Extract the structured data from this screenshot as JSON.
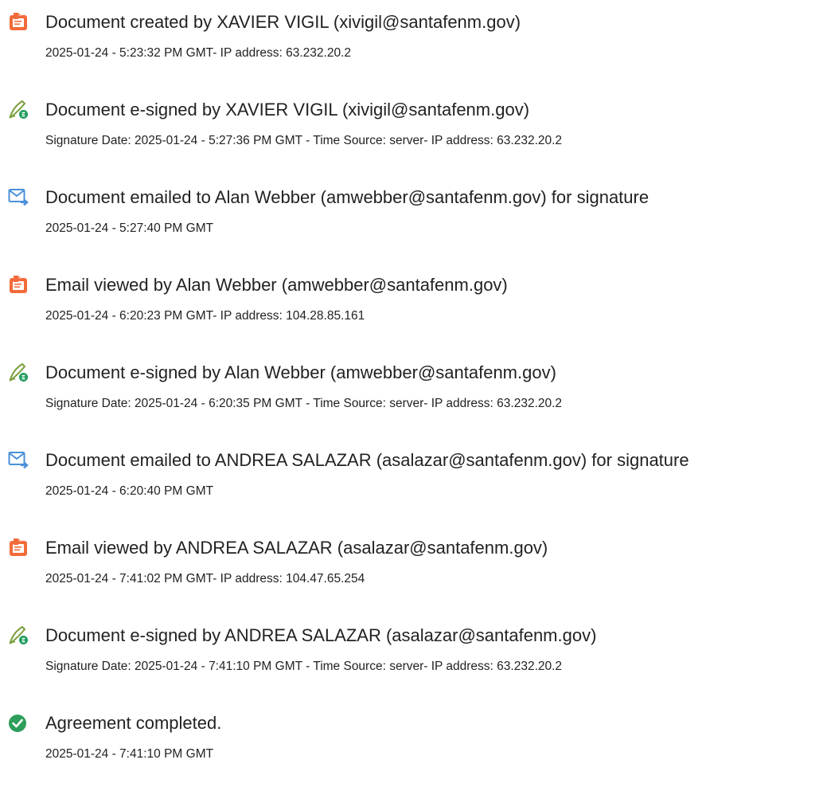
{
  "events": [
    {
      "icon": "document-created-icon",
      "title": "Document created by XAVIER VIGIL (xivigil@santafenm.gov)",
      "detail": "2025-01-24 - 5:23:32 PM GMT- IP address: 63.232.20.2"
    },
    {
      "icon": "e-signed-icon",
      "title": "Document e-signed by XAVIER VIGIL (xivigil@santafenm.gov)",
      "detail": "Signature Date: 2025-01-24 - 5:27:36 PM GMT - Time Source: server- IP address: 63.232.20.2"
    },
    {
      "icon": "email-sent-icon",
      "title": "Document emailed to Alan Webber (amwebber@santafenm.gov) for signature",
      "detail": "2025-01-24 - 5:27:40 PM GMT"
    },
    {
      "icon": "email-viewed-icon",
      "title": "Email viewed by Alan Webber (amwebber@santafenm.gov)",
      "detail": "2025-01-24 - 6:20:23 PM GMT- IP address: 104.28.85.161"
    },
    {
      "icon": "e-signed-icon",
      "title": "Document e-signed by Alan Webber (amwebber@santafenm.gov)",
      "detail": "Signature Date: 2025-01-24 - 6:20:35 PM GMT - Time Source: server- IP address: 63.232.20.2"
    },
    {
      "icon": "email-sent-icon",
      "title": "Document emailed to ANDREA SALAZAR (asalazar@santafenm.gov) for signature",
      "detail": "2025-01-24 - 6:20:40 PM GMT"
    },
    {
      "icon": "email-viewed-icon",
      "title": "Email viewed by ANDREA SALAZAR (asalazar@santafenm.gov)",
      "detail": "2025-01-24 - 7:41:02 PM GMT- IP address: 104.47.65.254"
    },
    {
      "icon": "e-signed-icon",
      "title": "Document e-signed by ANDREA SALAZAR (asalazar@santafenm.gov)",
      "detail": "Signature Date: 2025-01-24 - 7:41:10 PM GMT - Time Source: server- IP address: 63.232.20.2"
    },
    {
      "icon": "agreement-completed-icon",
      "title": "Agreement completed.",
      "detail": "2025-01-24 - 7:41:10 PM GMT"
    }
  ],
  "colors": {
    "document_icon": "#f26b3a",
    "sign_icon": "#7a9e3c",
    "sign_badge": "#1f9c5c",
    "email_icon": "#4a90d9",
    "complete_icon": "#2e9e5b",
    "text": "#222222"
  }
}
